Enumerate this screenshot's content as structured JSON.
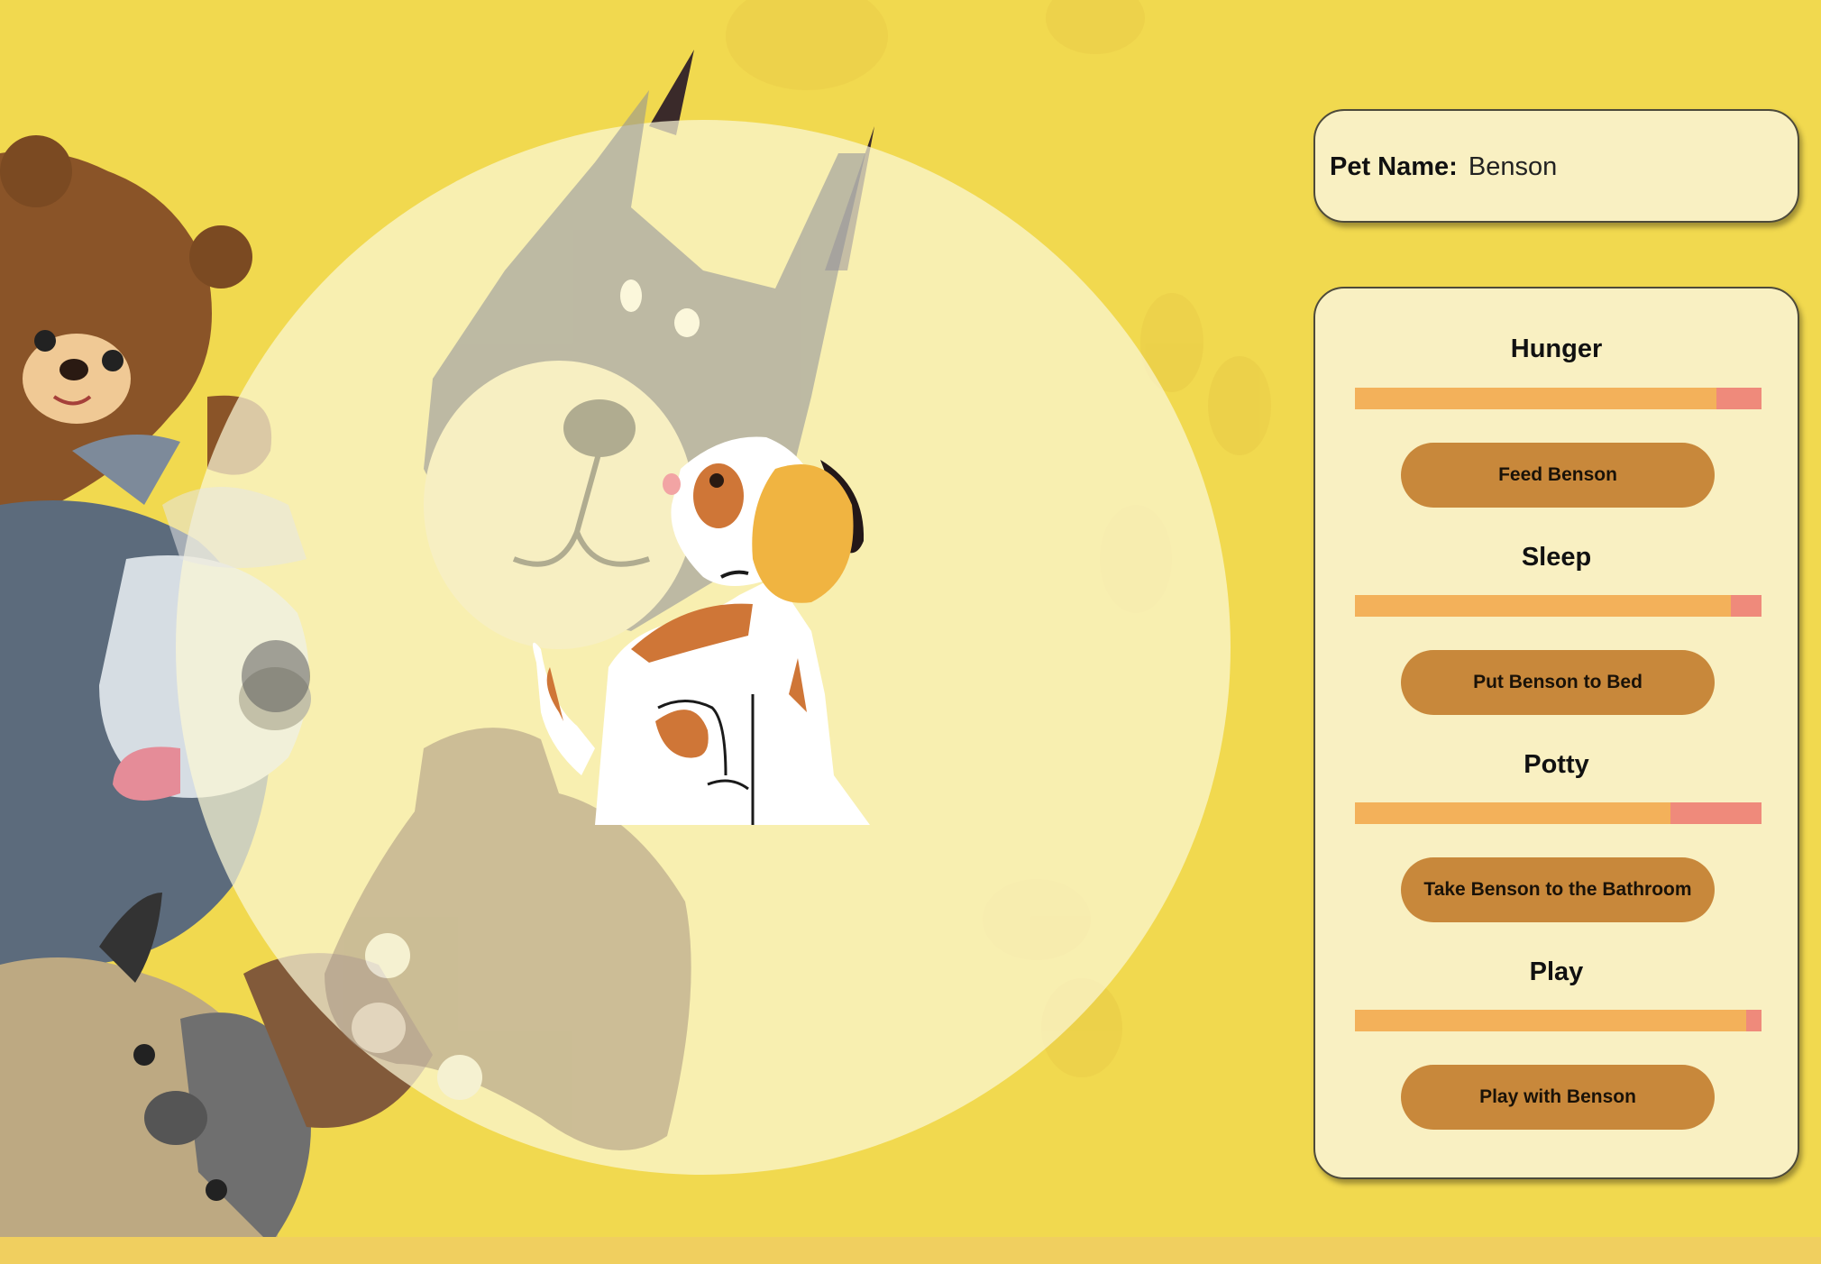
{
  "pet": {
    "name_label": "Pet Name:",
    "name": "Benson"
  },
  "stats": [
    {
      "label": "Hunger",
      "level": 0.89,
      "button": "Feed Benson"
    },
    {
      "label": "Sleep",
      "level": 0.925,
      "button": "Put Benson to Bed"
    },
    {
      "label": "Potty",
      "level": 0.775,
      "button": "Take Benson to the Bathroom"
    },
    {
      "label": "Play",
      "level": 0.962,
      "button": "Play with Benson"
    }
  ],
  "colors": {
    "background": "#f1d94f",
    "card": "#f9f0c2",
    "bar_fill": "#f3b15a",
    "bar_empty": "#ef8a7b",
    "button": "#c8883b"
  },
  "icons": [
    "teddy-bear-illustration",
    "husky-dog-illustration",
    "doberman-dog-illustration",
    "pug-dog-illustration",
    "chihuahua-dog-illustration",
    "puppy-pet-illustration"
  ]
}
